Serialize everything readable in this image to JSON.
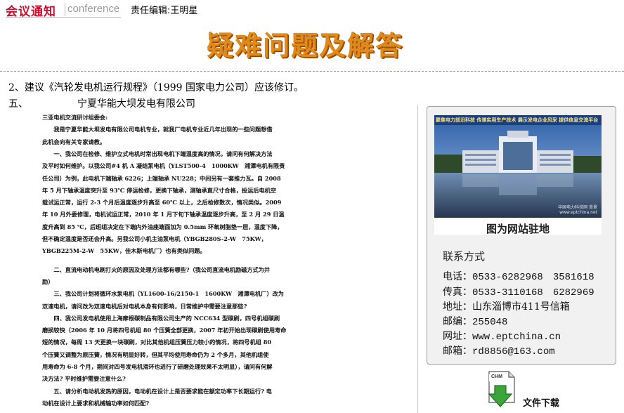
{
  "header": {
    "logo_cn": "会议通知",
    "logo_en": "conference",
    "editor": "责任编辑:王明星"
  },
  "main": {
    "title": "疑难问题及解答",
    "item2": "2、建议《汽轮发电机运行规程》（1999 国家电力公司）应该修订。",
    "item5_num": "五、",
    "item5_org": "宁夏华能大坝发电有限公司"
  },
  "scan": {
    "lines": [
      "三亚电机交流研讨组委会:",
      "　　我是宁夏华能大坝发电有限公司电机专业，就我厂电机专业近几年出现的一些问题想借",
      "此机会向有关专家请教。",
      "　　一、我公司在检修、维护立式电机时常出现电机下端温度高的情况，请问有何解决方法",
      "及平时如何维护。以我公司#4 机 A 凝结泵电机（YLST500-4　1000KW　湘潭电机有限责",
      "任公司）为例，此电机下端轴承 6226；上端轴承 NU228；中间另有一套推力瓦。自 2008",
      "年 5 月下轴承温度突升至 93℃ 停运检修，更换下轴承，测轴承直尺寸合格，投运后电机空",
      "载试运正常，运行 2-3 个月后温度逐步升高至 60℃ 以上，之后检修数次，情况类似。2009",
      "年 10 月外委修理，电机试运正常，2010 年 1 月下旬下轴承温度逐步升高，至 2 月 29 日温",
      "度升高到 85 ℃，后班组决定在下端内外油座端面加为 0.5mm 环氧树脂垫一层，温度下降，",
      "但不确定温度是否还会升高。另我公司小机主油泵电机（YBGB280S-2-W　75KW，",
      "YBGB225M-2-W　55KW，佳木斯电机厂）也有类似问题。",
      "",
      "　　二、直流电动机电刷打火的原因及处理方法都有哪些?（我公司直流电机励磁方式为并",
      "励）",
      "　　三、我公司计划将循环水泵电机（YL1600-16/2150-1　1600KW　湘潭电机厂）改为",
      "双速电机，请问改为双速电机后对电机本身有何影响，日常维护中需要注意那些?",
      "　　四、我公司发电机使用上海摩根碳制品有限公司生产的 NCC634 型碳刷，四号机组碳刷",
      "磨损较快（2006 年 10 月将四号机组 80 个压簧全部更换，2007 年初开始出现碳刷使用寿命",
      "短的情况，每周 13 天更换一块碳刷，对比其他机组压簧压力较小的情况，将四号机组 80",
      "个压簧又调整为原压簧，情况有明显好转，但其平均使用寿命仍为 2 个多月，其他机组使",
      "用寿命为 6-8 个月，期间对四号发电机滑环也进行了研磨处理效果不太明显），请问有何解",
      "决方法? 平时维护需要注意什么?",
      "　　五、请分析电动机发热的原因，电动机在设计上是否要求能在额定功率下长期运行? 电",
      "动机在设计上要求和机械输功率如何匹配?"
    ]
  },
  "sidebar": {
    "banner_text": "聚焦电力前沿科技 传递实用生产技术 展示发电企业风采 提供信息交流平台",
    "watermark": "中国电力科技网 背景",
    "watermark_url": "www.eptchina.net",
    "caption": "图为网站驻地",
    "contact_title": "联系方式",
    "contacts": [
      {
        "label": "电话：",
        "value": "0533-6282968　3581618"
      },
      {
        "label": "传真：",
        "value": "0533-3110168　6282969"
      },
      {
        "label": "地址：",
        "value": "山东淄博市411号信箱"
      },
      {
        "label": "邮编：",
        "value": "255048"
      },
      {
        "label": "网址：",
        "value": "www.eptchina.cn"
      },
      {
        "label": "邮箱：",
        "value": "rd8856@163.com"
      }
    ]
  },
  "download": {
    "file_type": "CHM",
    "label": "文件下载"
  },
  "colors": {
    "logo_red": "#c8102e",
    "title_orange": "#e08a1a",
    "download_green": "#3aa53a",
    "box_bg": "#f1f1f1"
  }
}
